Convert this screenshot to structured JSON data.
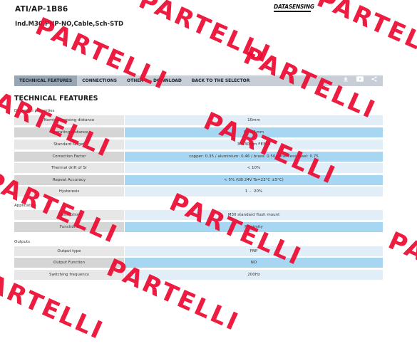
{
  "product": {
    "model": "ATI/AP-1B86",
    "description": "Ind.M30,PNP-NO,Cable,Sch-STD",
    "brand_logo": "DATASENSING"
  },
  "nav": {
    "tabs": [
      "TECHNICAL FEATURES",
      "CONNECTIONS",
      "OTHER",
      "DOWNLOAD",
      "BACK TO THE SELECTOR"
    ],
    "active": 0,
    "icons": [
      "download-icon",
      "youtube-icon",
      "share-icon"
    ]
  },
  "section_title": "TECHNICAL FEATURES",
  "groups": [
    {
      "label": "Detection properties",
      "rows": [
        {
          "label": "Nominal sensing distance",
          "value": "10mm"
        },
        {
          "label": "Operating distance",
          "value": "0...8.1mm"
        },
        {
          "label": "Standard target",
          "value": "30x30mm FE360"
        },
        {
          "label": "Correction Factor",
          "value": "copper: 0.35 / aluminium: 0.46 / brass: 0.50 / stainless steel: 0.75"
        },
        {
          "label": "Thermal drift of Sr",
          "value": "< 10%"
        },
        {
          "label": "Repeat Accuracy",
          "value": "< 5% (UB 24V Ta=23°C ±5°C)"
        },
        {
          "label": "Hysteresis",
          "value": "1 ... 20%"
        }
      ]
    },
    {
      "label": "Application",
      "rows": [
        {
          "label": "Description",
          "value": "M30 standard flush mount"
        },
        {
          "label": "Functions",
          "value": "Proximity"
        }
      ]
    },
    {
      "label": "Outputs",
      "rows": [
        {
          "label": "Output type",
          "value": "PNP"
        },
        {
          "label": "Output Function",
          "value": "NO"
        },
        {
          "label": "Switching frequency",
          "value": "200Hz"
        }
      ]
    }
  ],
  "watermark": "PARTELLI",
  "colors": {
    "watermark": "#ec0a31",
    "nav_bar": "#c7ced6",
    "nav_active": "#98a6b3",
    "row_value_alt": "#a7d6f2",
    "row_value": "#e1edf7"
  }
}
